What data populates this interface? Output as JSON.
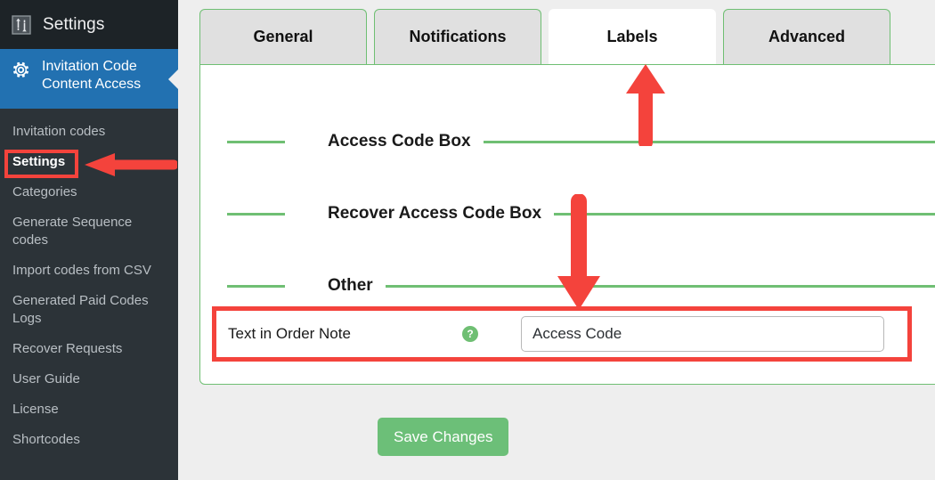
{
  "wp_header": {
    "title": "Settings",
    "icon": "settings-sliders-icon"
  },
  "sidebar": {
    "current_plugin": {
      "label": "Invitation Code Content Access",
      "icon": "gear-icon",
      "color": "#2271b1"
    },
    "items": [
      {
        "label": "Invitation codes",
        "active": false
      },
      {
        "label": "Settings",
        "active": true
      },
      {
        "label": "Categories",
        "active": false
      },
      {
        "label": "Generate Sequence codes",
        "active": false
      },
      {
        "label": "Import codes from CSV",
        "active": false
      },
      {
        "label": "Generated Paid Codes Logs",
        "active": false
      },
      {
        "label": "Recover Requests",
        "active": false
      },
      {
        "label": "User Guide",
        "active": false
      },
      {
        "label": "License",
        "active": false
      },
      {
        "label": "Shortcodes",
        "active": false
      }
    ]
  },
  "tabs": [
    {
      "label": "General",
      "active": false
    },
    {
      "label": "Notifications",
      "active": false
    },
    {
      "label": "Labels",
      "active": true
    },
    {
      "label": "Advanced",
      "active": false
    }
  ],
  "panel": {
    "sections": [
      {
        "title": "Access Code Box"
      },
      {
        "title": "Recover Access Code Box"
      },
      {
        "title": "Other"
      }
    ],
    "field": {
      "label": "Text in Order Note",
      "help_icon": "?",
      "value": "Access Code",
      "placeholder": "Access Code"
    }
  },
  "footer": {
    "save_label": "Save Changes"
  },
  "annotations": {
    "highlight_color": "#f4433c",
    "arrow_color": "#f4433c",
    "items": [
      {
        "name": "settings-menu-highlight",
        "target": "Settings"
      },
      {
        "name": "labels-tab-highlight",
        "target": "Labels"
      },
      {
        "name": "order-note-field-highlight",
        "target": "Text in Order Note"
      },
      {
        "name": "arrow-to-settings",
        "direction": "left"
      },
      {
        "name": "arrow-to-labels-tab",
        "direction": "up"
      },
      {
        "name": "arrow-to-order-note",
        "direction": "down"
      }
    ]
  },
  "theme": {
    "accent_green": "#6fbf73",
    "sidebar_bg": "#23282d",
    "submenu_bg": "#2c3338",
    "page_bg": "#eeeeee"
  }
}
